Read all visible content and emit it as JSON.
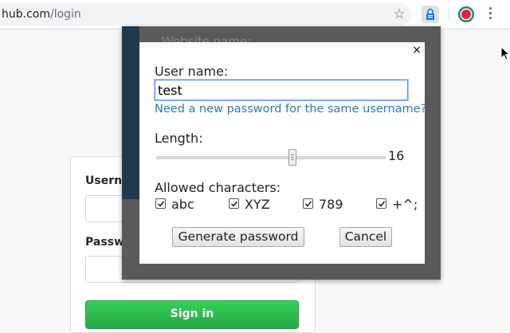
{
  "browser": {
    "url_host": "hub.com",
    "url_path": "/login",
    "icons": [
      "star-icon",
      "lock-extension-icon",
      "record-extension-icon",
      "menu-dots-icon"
    ]
  },
  "login_page": {
    "username_label": "Userna",
    "password_label": "Passwo",
    "signin_label": "Sign in",
    "colors": {
      "signin": "#2ea44f"
    }
  },
  "popup": {
    "header_text": "Website name:",
    "close_label": "×",
    "username_label": "User name:",
    "username_value": "test",
    "new_password_link": "Need a new password for the same username?",
    "length_label": "Length:",
    "length_value": "16",
    "length_fraction": 0.59,
    "allowed_label": "Allowed characters:",
    "charsets": [
      {
        "label": "abc",
        "checked": true
      },
      {
        "label": "XYZ",
        "checked": true
      },
      {
        "label": "789",
        "checked": true
      },
      {
        "label": "+^;",
        "checked": true
      }
    ],
    "generate_label": "Generate password",
    "cancel_label": "Cancel",
    "colors": {
      "link": "#2a7ab8",
      "focus": "#4d90fe",
      "overlay": "#5a5a5a"
    }
  }
}
